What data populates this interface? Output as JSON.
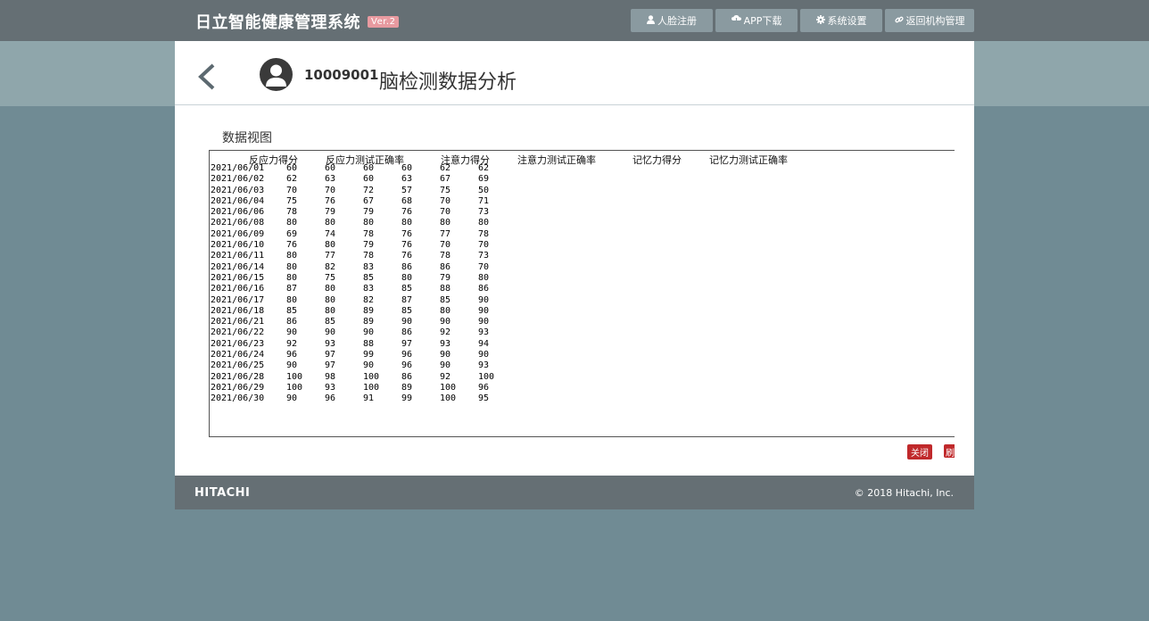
{
  "header": {
    "brand": "日立智能健康管理系统",
    "version_badge": "Ver.2",
    "nav": [
      {
        "label": "人脸注册",
        "icon": "user-icon"
      },
      {
        "label": "APP下载",
        "icon": "cloud-download-icon"
      },
      {
        "label": "系统设置",
        "icon": "gear-icon"
      },
      {
        "label": "返回机构管理",
        "icon": "link-icon"
      }
    ]
  },
  "page": {
    "user_id": "10009001",
    "title": "脑检测数据分析",
    "section_label": "数据视图"
  },
  "table": {
    "columns": [
      "反应力得分",
      "反应力测试正确率",
      "注意力得分",
      "注意力测试正确率",
      "记忆力得分",
      "记忆力测试正确率"
    ],
    "rows": [
      [
        "2021/06/01",
        "60",
        "60",
        "60",
        "60",
        "62",
        "62"
      ],
      [
        "2021/06/02",
        "62",
        "63",
        "60",
        "63",
        "67",
        "69"
      ],
      [
        "2021/06/03",
        "70",
        "70",
        "72",
        "57",
        "75",
        "50"
      ],
      [
        "2021/06/04",
        "75",
        "76",
        "67",
        "68",
        "70",
        "71"
      ],
      [
        "2021/06/06",
        "78",
        "79",
        "79",
        "76",
        "70",
        "73"
      ],
      [
        "2021/06/08",
        "80",
        "80",
        "80",
        "80",
        "80",
        "80"
      ],
      [
        "2021/06/09",
        "69",
        "74",
        "78",
        "76",
        "77",
        "78"
      ],
      [
        "2021/06/10",
        "76",
        "80",
        "79",
        "76",
        "70",
        "70"
      ],
      [
        "2021/06/11",
        "80",
        "77",
        "78",
        "76",
        "78",
        "73"
      ],
      [
        "2021/06/14",
        "80",
        "82",
        "83",
        "86",
        "86",
        "70"
      ],
      [
        "2021/06/15",
        "80",
        "75",
        "85",
        "80",
        "79",
        "80"
      ],
      [
        "2021/06/16",
        "87",
        "80",
        "83",
        "85",
        "88",
        "86"
      ],
      [
        "2021/06/17",
        "80",
        "80",
        "82",
        "87",
        "85",
        "90"
      ],
      [
        "2021/06/18",
        "85",
        "80",
        "89",
        "85",
        "80",
        "90"
      ],
      [
        "2021/06/21",
        "86",
        "85",
        "89",
        "90",
        "90",
        "90"
      ],
      [
        "2021/06/22",
        "90",
        "90",
        "90",
        "86",
        "92",
        "93"
      ],
      [
        "2021/06/23",
        "92",
        "93",
        "88",
        "97",
        "93",
        "94"
      ],
      [
        "2021/06/24",
        "96",
        "97",
        "99",
        "96",
        "90",
        "90"
      ],
      [
        "2021/06/25",
        "90",
        "97",
        "90",
        "96",
        "90",
        "93"
      ],
      [
        "2021/06/28",
        "100",
        "98",
        "100",
        "86",
        "92",
        "100"
      ],
      [
        "2021/06/29",
        "100",
        "93",
        "100",
        "89",
        "100",
        "96"
      ],
      [
        "2021/06/30",
        "90",
        "96",
        "91",
        "99",
        "100",
        "95"
      ]
    ]
  },
  "actions": {
    "close_label": "关闭",
    "second_label": "刷"
  },
  "footer": {
    "logo": "HITACHI",
    "copyright": "© 2018 Hitachi, Inc."
  },
  "colors": {
    "topbar": "#656f74",
    "background": "#708b94",
    "nav_button": "#8a9aa0",
    "badge": "#e89aa0",
    "action_red": "#c0292b"
  }
}
